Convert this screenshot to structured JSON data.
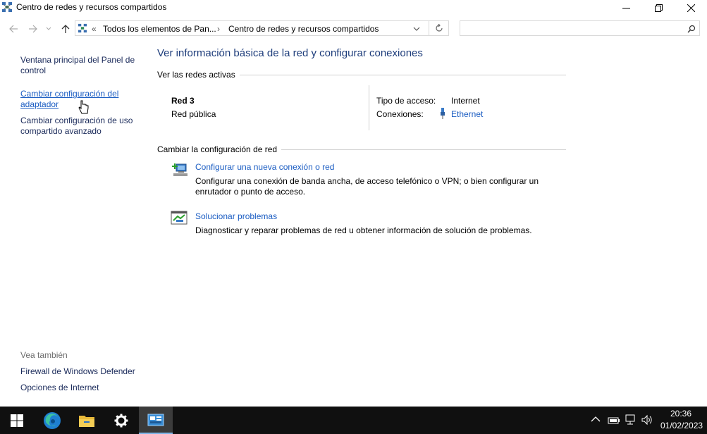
{
  "window": {
    "title": "Centro de redes y recursos compartidos",
    "minimize_glyph": "—",
    "maximize_glyph": "❐",
    "close_glyph": "✕"
  },
  "address": {
    "back_icon": "arrow-left-icon",
    "forward_icon": "arrow-right-icon",
    "up_icon": "arrow-up-icon",
    "overflow": "«",
    "crumb1": "Todos los elementos de Pan...",
    "sep": "›",
    "crumb2": "Centro de redes y recursos compartidos",
    "search_placeholder": ""
  },
  "left": {
    "home": "Ventana principal del Panel de control",
    "adapter": "Cambiar configuración del adaptador",
    "sharing": "Cambiar configuración de uso compartido avanzado",
    "see_also": "Vea también",
    "firewall": "Firewall de Windows Defender",
    "internet_options": "Opciones de Internet"
  },
  "main": {
    "title": "Ver información básica de la red y configurar conexiones",
    "active_networks_header": "Ver las redes activas",
    "network_name": "Red 3",
    "network_type": "Red pública",
    "access_type_label": "Tipo de acceso:",
    "access_type_value": "Internet",
    "connections_label": "Conexiones:",
    "connections_value": "Ethernet",
    "change_header": "Cambiar la configuración de red",
    "new_conn_link": "Configurar una nueva conexión o red",
    "new_conn_desc": "Configurar una conexión de banda ancha, de acceso telefónico o VPN; o bien configurar un enrutador o punto de acceso.",
    "troubleshoot_link": "Solucionar problemas",
    "troubleshoot_desc": "Diagnosticar y reparar problemas de red u obtener información de solución de problemas."
  },
  "taskbar": {
    "time": "20:36",
    "date": "01/02/2023"
  },
  "colors": {
    "link": "#1a5cc2",
    "title": "#1e3d7b",
    "taskbar": "#101010"
  }
}
